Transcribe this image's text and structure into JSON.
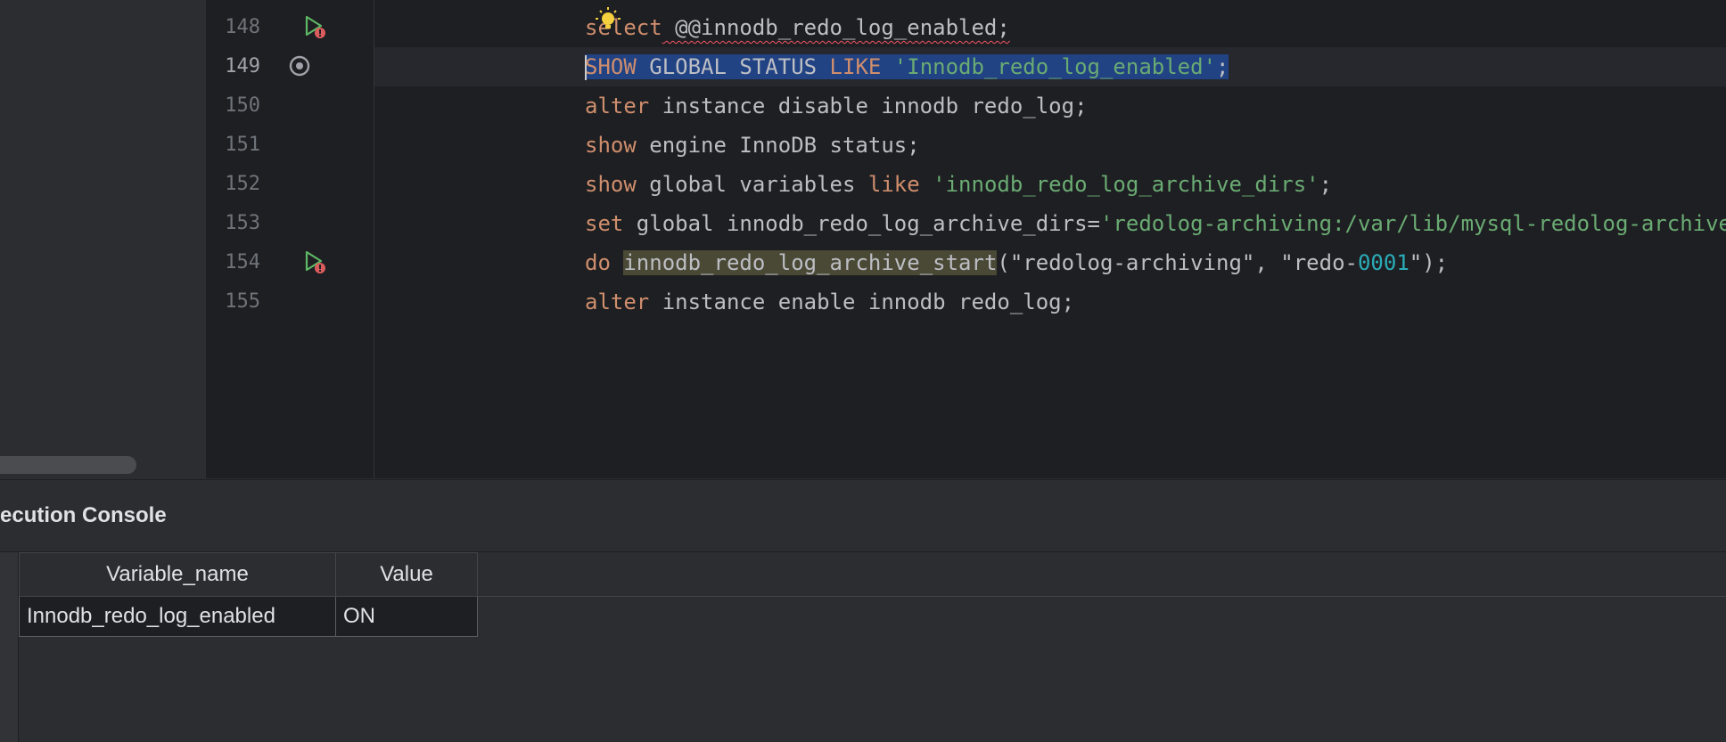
{
  "editor": {
    "lines": [
      {
        "num": "148",
        "tokens": [
          {
            "t": "se",
            "c": "kw"
          },
          {
            "t": "lect",
            "c": "kw"
          },
          {
            "t": " @@innodb_redo_log_enabled;",
            "c": ""
          }
        ]
      },
      {
        "num": "149",
        "tokens": [
          {
            "t": "SHOW",
            "c": "kw"
          },
          {
            "t": " GLOBAL STATUS ",
            "c": ""
          },
          {
            "t": "LIKE",
            "c": "kw"
          },
          {
            "t": " ",
            "c": ""
          },
          {
            "t": "'Innodb_redo_log_enabled'",
            "c": "str"
          },
          {
            "t": ";",
            "c": ""
          }
        ]
      },
      {
        "num": "150",
        "tokens": [
          {
            "t": "alter",
            "c": "kw"
          },
          {
            "t": " instance disable innodb redo_log;",
            "c": ""
          }
        ]
      },
      {
        "num": "151",
        "tokens": [
          {
            "t": "show",
            "c": "kw"
          },
          {
            "t": " engine InnoDB status;",
            "c": ""
          }
        ]
      },
      {
        "num": "152",
        "tokens": [
          {
            "t": "show",
            "c": "kw"
          },
          {
            "t": " global variables ",
            "c": ""
          },
          {
            "t": "like",
            "c": "kw"
          },
          {
            "t": " ",
            "c": ""
          },
          {
            "t": "'innodb_redo_log_archive_dirs'",
            "c": "str"
          },
          {
            "t": ";",
            "c": ""
          }
        ]
      },
      {
        "num": "153",
        "tokens": [
          {
            "t": "set",
            "c": "kw"
          },
          {
            "t": " global innodb_redo_log_archive_dirs=",
            "c": ""
          },
          {
            "t": "'redolog-archiving:/var/lib/mysql-redolog-archive'",
            "c": "str"
          },
          {
            "t": ";",
            "c": ""
          }
        ]
      },
      {
        "num": "154",
        "tokens": [
          {
            "t": "do",
            "c": "kw"
          },
          {
            "t": " ",
            "c": ""
          },
          {
            "t": "innodb_redo_log_archive_start",
            "c": "fnhl"
          },
          {
            "t": "(\"redolog-archiving\", \"redo-",
            "c": ""
          },
          {
            "t": "0001",
            "c": "num"
          },
          {
            "t": "\");",
            "c": ""
          }
        ]
      },
      {
        "num": "155",
        "tokens": [
          {
            "t": "alter",
            "c": "kw"
          },
          {
            "t": " instance enable innodb redo_log;",
            "c": ""
          }
        ]
      }
    ]
  },
  "console": {
    "title": "ecution Console",
    "columns": [
      "Variable_name",
      "Value"
    ],
    "rows": [
      [
        "Innodb_redo_log_enabled",
        "ON"
      ]
    ]
  },
  "colors": {
    "keyword": "#cf8e6d",
    "string": "#6aab73",
    "number": "#2aacb8",
    "selection": "#214283",
    "run_icon": "#5fb865",
    "error_badge": "#db5c5c"
  },
  "icons": {
    "gutter_148": "run-icon-with-error",
    "gutter_149": "settings-icon",
    "gutter_154": "run-icon-with-error",
    "intention": "lightbulb-icon"
  }
}
